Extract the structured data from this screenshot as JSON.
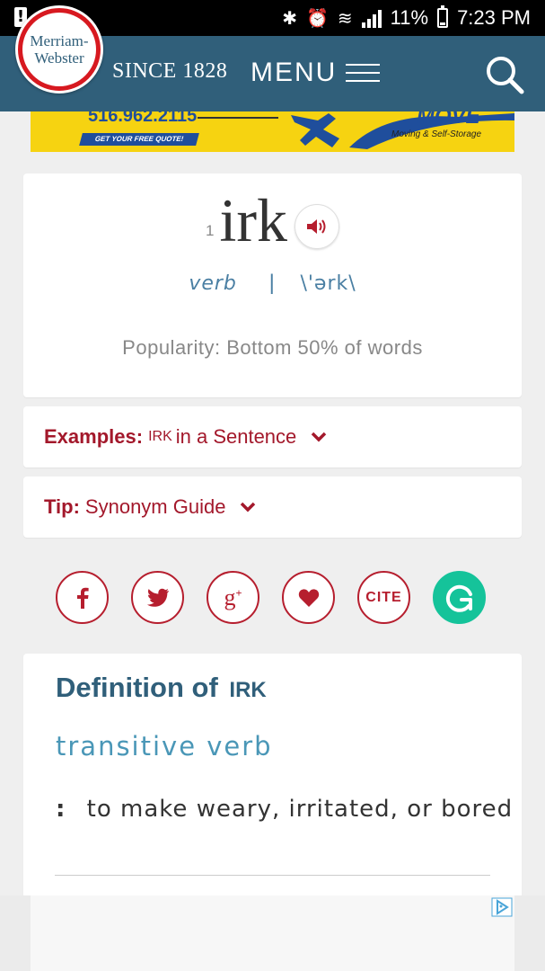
{
  "status_bar": {
    "battery": "11%",
    "time": "7:23 PM"
  },
  "header": {
    "logo_line1": "Merriam-",
    "logo_line2": "Webster",
    "since": "SINCE 1828",
    "menu": "MENU"
  },
  "ad_banner": {
    "phone": "516.962.2115",
    "cta": "GET YOUR FREE QUOTE!",
    "brand": "MOVE",
    "tagline": "Moving & Self-Storage"
  },
  "entry": {
    "homograph": "1",
    "headword": "irk",
    "part_of_speech": "verb",
    "separator": "|",
    "pronunciation": "\\'ərk\\",
    "popularity": "Popularity: Bottom 50% of words"
  },
  "examples": {
    "label": "Examples:",
    "word": "irk",
    "rest": "in a Sentence"
  },
  "tip": {
    "label": "Tip:",
    "rest": "Synonym Guide"
  },
  "social": {
    "cite": "CITE"
  },
  "definition": {
    "title": "Definition of",
    "word": "irk",
    "pos": "transitive verb",
    "colon": ":",
    "text": "to make weary, irritated, or bored"
  },
  "colors": {
    "header": "#305f7a",
    "accent_red": "#a3182b",
    "grammarly": "#15c39a"
  }
}
